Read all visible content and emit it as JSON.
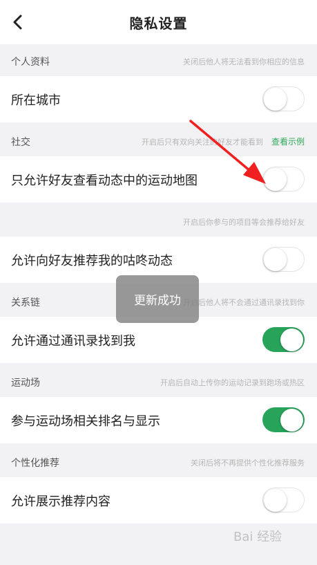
{
  "header": {
    "title": "隐私设置"
  },
  "sections": {
    "personal": {
      "label": "个人资料",
      "desc": "关闭后他人将无法看到你相应的信息"
    },
    "social": {
      "label": "社交",
      "desc": "开启后只有双向关注的好友才能看到",
      "link": "查看示例"
    },
    "social2": {
      "desc": "开启后你参与的项目等会推荐给好友"
    },
    "relation": {
      "label": "关系链",
      "desc": "开启后他人将不会通过通讯录找到你"
    },
    "sports": {
      "label": "运动场",
      "desc": "开启后自动上传你的运动记录到跑场或热区"
    },
    "personalize": {
      "label": "个性化推荐",
      "desc": "关闭后将不再提供个性化推荐服务"
    }
  },
  "rows": [
    {
      "label": "所在城市",
      "on": false
    },
    {
      "label": "只允许好友查看动态中的运动地图",
      "on": false
    },
    {
      "label": "允许向好友推荐我的咕咚动态",
      "on": false
    },
    {
      "label": "允许通过通讯录找到我",
      "on": true
    },
    {
      "label": "参与运动场相关排名与显示",
      "on": true
    },
    {
      "label": "允许展示推荐内容",
      "on": false
    }
  ],
  "toast": {
    "text": "更新成功"
  },
  "watermark": {
    "text": "Bai 经验"
  },
  "colors": {
    "accent": "#27a35a",
    "arrow": "#f02020"
  },
  "icons": {
    "back": "chevron-left-icon"
  }
}
